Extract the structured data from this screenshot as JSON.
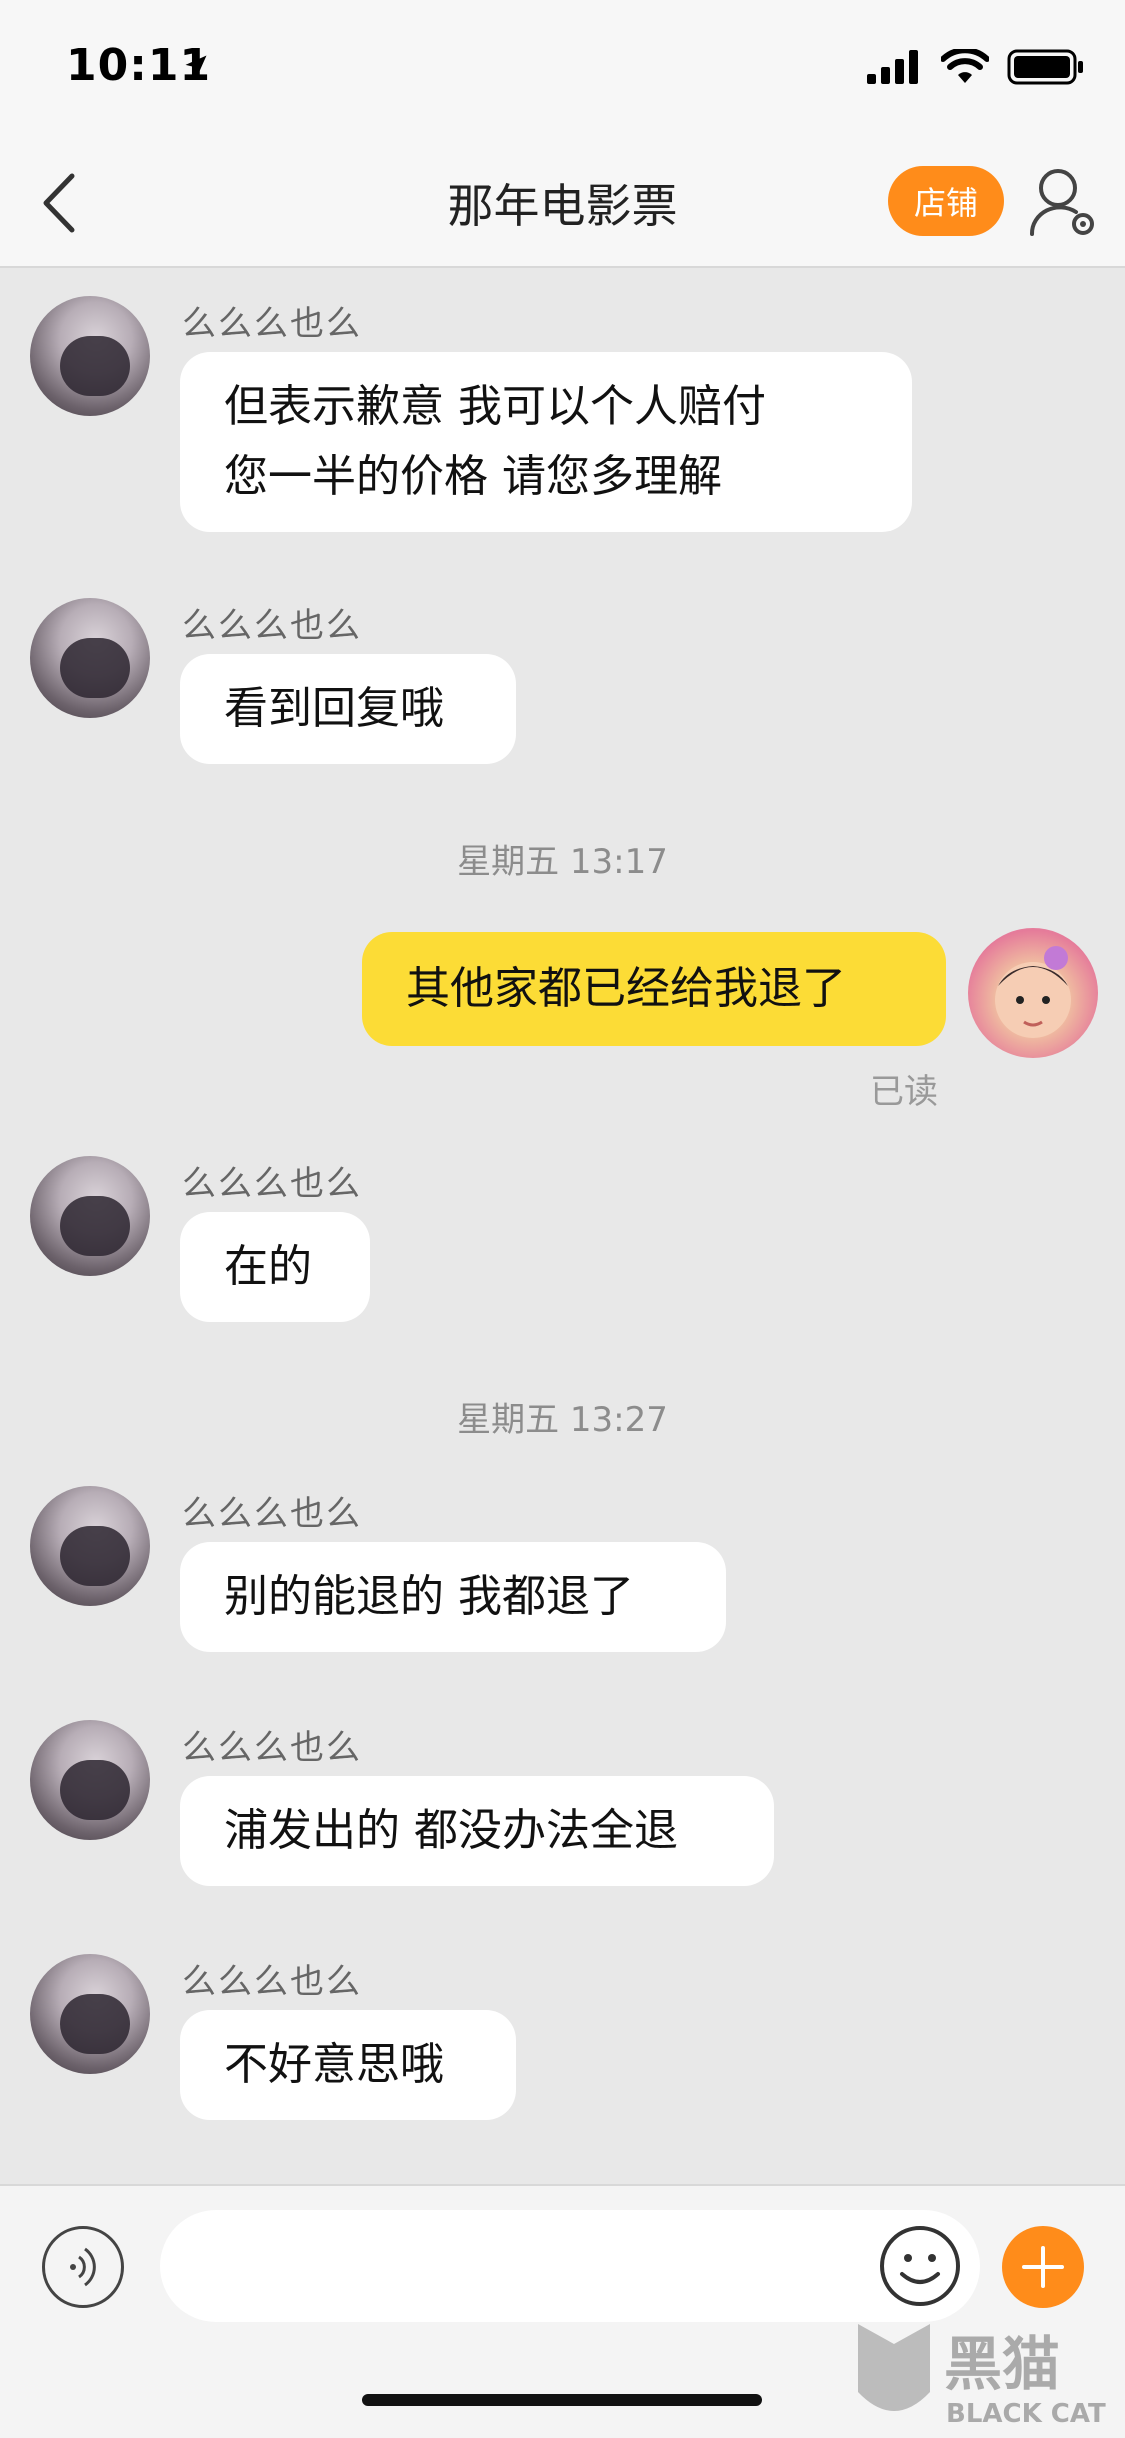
{
  "status_bar": {
    "time": "10:11",
    "icons": [
      "location-arrow-icon",
      "signal-icon",
      "wifi-icon",
      "battery-icon"
    ]
  },
  "nav": {
    "title": "那年电影票",
    "shop_label": "店铺"
  },
  "messages": [
    {
      "sender": "么么么也么",
      "text_lines": [
        "但表示歉意 我可以个人赔付",
        "您一半的价格 请您多理解"
      ]
    },
    {
      "sender": "么么么也么",
      "text": "看到回复哦"
    },
    {
      "timestamp": "星期五 13:17"
    },
    {
      "self": true,
      "text": "其他家都已经给我退了",
      "status": "已读"
    },
    {
      "sender": "么么么也么",
      "text": "在的"
    },
    {
      "timestamp": "星期五 13:27"
    },
    {
      "sender": "么么么也么",
      "text": "别的能退的 我都退了"
    },
    {
      "sender": "么么么也么",
      "text": "浦发出的 都没办法全退"
    },
    {
      "sender": "么么么也么",
      "text": "不好意思哦"
    }
  ],
  "watermark": {
    "brand_cn": "黑猫",
    "brand_en": "BLACK CAT"
  },
  "colors": {
    "accent": "#ff8c1a",
    "self_bubble": "#fcdc36",
    "chat_bg": "#e8e8e8"
  }
}
